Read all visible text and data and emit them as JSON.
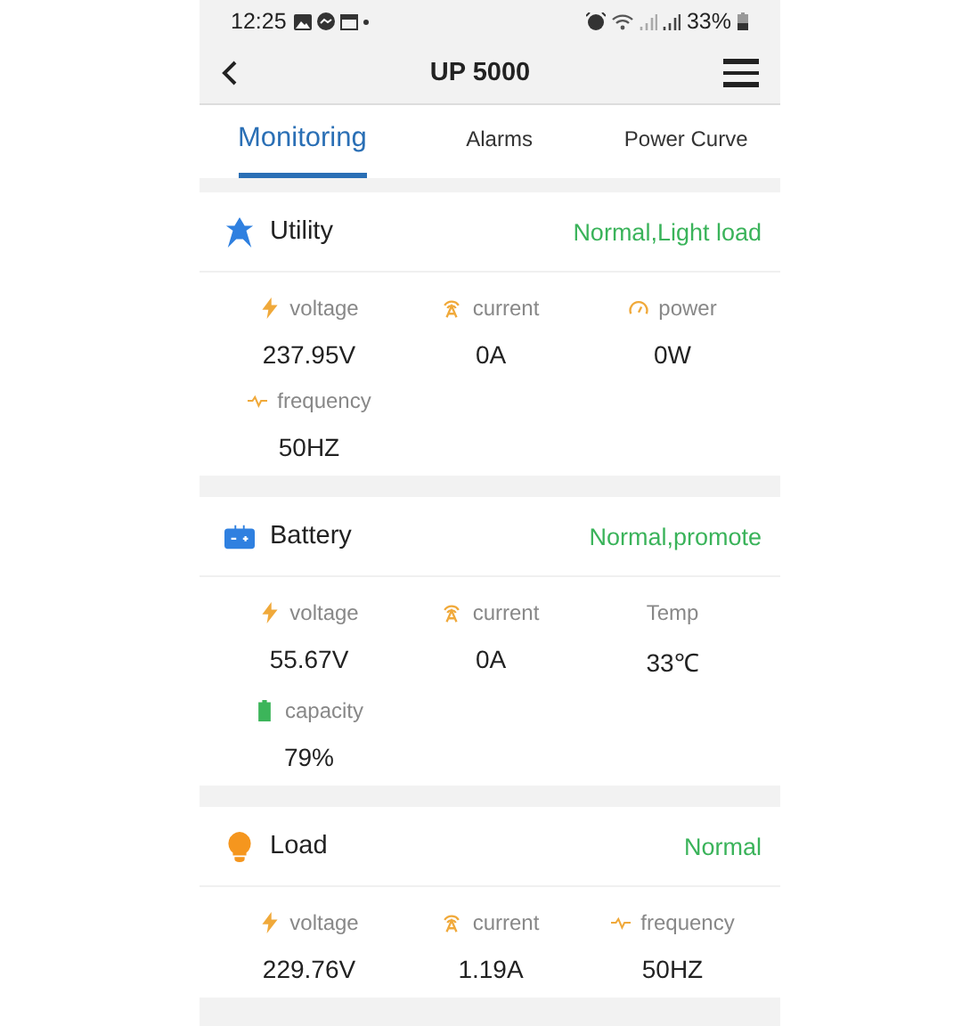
{
  "status_bar": {
    "time": "12:25",
    "battery": "33%"
  },
  "header": {
    "title": "UP 5000"
  },
  "tabs": [
    {
      "label": "Monitoring",
      "selected": true
    },
    {
      "label": "Alarms",
      "selected": false
    },
    {
      "label": "Power Curve",
      "selected": false
    }
  ],
  "sections": [
    {
      "kind": "utility",
      "title": "Utility",
      "status": "Normal,Light load",
      "metrics": [
        {
          "kind": "voltage",
          "label": "voltage",
          "value": "237.95V"
        },
        {
          "kind": "current",
          "label": "current",
          "value": "0A"
        },
        {
          "kind": "power",
          "label": "power",
          "value": "0W"
        },
        {
          "kind": "frequency",
          "label": "frequency",
          "value": "50HZ"
        }
      ]
    },
    {
      "kind": "battery",
      "title": "Battery",
      "status": "Normal,promote",
      "metrics": [
        {
          "kind": "voltage",
          "label": "voltage",
          "value": "55.67V"
        },
        {
          "kind": "current",
          "label": "current",
          "value": "0A"
        },
        {
          "kind": "plain",
          "label": "Temp",
          "value": "33℃"
        },
        {
          "kind": "capacity",
          "label": "capacity",
          "value": "79%"
        }
      ]
    },
    {
      "kind": "load",
      "title": "Load",
      "status": "Normal",
      "metrics": [
        {
          "kind": "voltage",
          "label": "voltage",
          "value": "229.76V"
        },
        {
          "kind": "current",
          "label": "current",
          "value": "1.19A"
        },
        {
          "kind": "frequency",
          "label": "frequency",
          "value": "50HZ"
        }
      ]
    }
  ]
}
